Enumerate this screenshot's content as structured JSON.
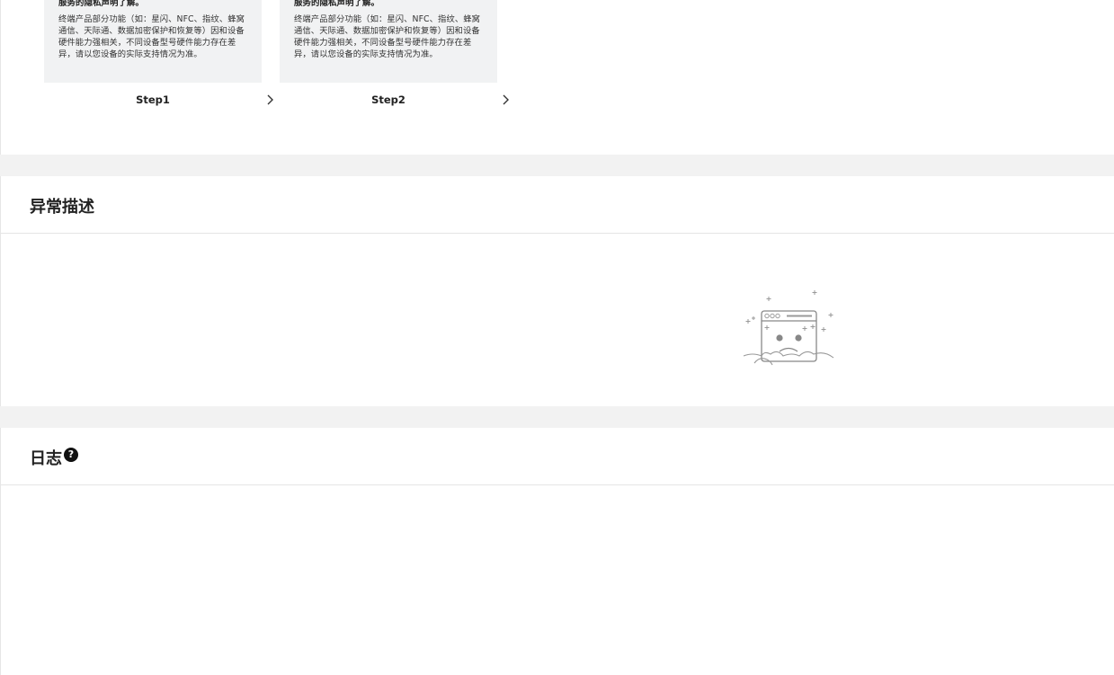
{
  "steps": [
    {
      "bold_text": "服务的隐私声明了解。",
      "body_text": "终端产品部分功能（如：星闪、NFC、指纹、蜂窝通信、天际通、数据加密保护和恢复等）因和设备硬件能力强相关，不同设备型号硬件能力存在差异，请以您设备的实际支持情况为准。",
      "label": "Step1"
    },
    {
      "bold_text": "服务的隐私声明了解。",
      "body_text": "终端产品部分功能（如：星闪、NFC、指纹、蜂窝通信、天际通、数据加密保护和恢复等）因和设备硬件能力强相关，不同设备型号硬件能力存在差异，请以您设备的实际支持情况为准。",
      "label": "Step2"
    }
  ],
  "anomaly": {
    "title": "异常描述",
    "empty_icon": "empty-state-sad-browser-icon"
  },
  "logs": {
    "title": "日志",
    "help_icon": "question-circle-icon",
    "help_glyph": "?"
  }
}
